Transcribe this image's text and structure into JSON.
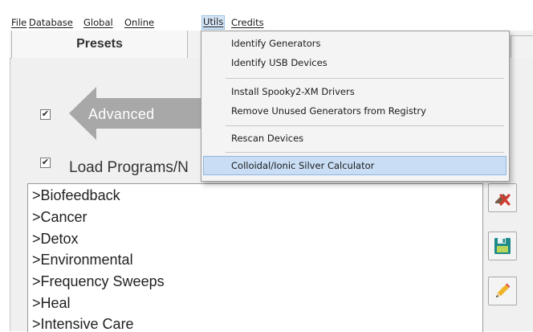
{
  "menubar": {
    "items": [
      {
        "label": "File"
      },
      {
        "label": "Database"
      },
      {
        "label": "Global"
      },
      {
        "label": "Online"
      },
      {
        "label": "Utils"
      },
      {
        "label": "Credits"
      }
    ]
  },
  "tabs": {
    "presets_label": "Presets"
  },
  "panel": {
    "advanced_checkbox_mark": "✔",
    "advanced_label": "Advanced",
    "load_checkbox_mark": "✔",
    "load_label": "Load Programs/N"
  },
  "program_list": {
    "items": [
      ">Biofeedback",
      ">Cancer",
      ">Detox",
      ">Environmental",
      ">Frequency Sweeps",
      ">Heal",
      ">Intensive Care"
    ]
  },
  "utils_menu": {
    "items": [
      "Identify Generators",
      "Identify USB Devices",
      "Install Spooky2-XM Drivers",
      "Remove Unused Generators from Registry",
      "Rescan Devices",
      "Colloidal/Ionic Silver Calculator"
    ]
  },
  "icons": {
    "delete": "delete-icon",
    "save": "save-icon",
    "edit": "pencil-icon"
  },
  "colors": {
    "arrow_gray": "#a8a8a8",
    "menu_highlight": "#c9def5",
    "delete_red": "#d23b2e",
    "save_teal": "#1f8a8a"
  }
}
